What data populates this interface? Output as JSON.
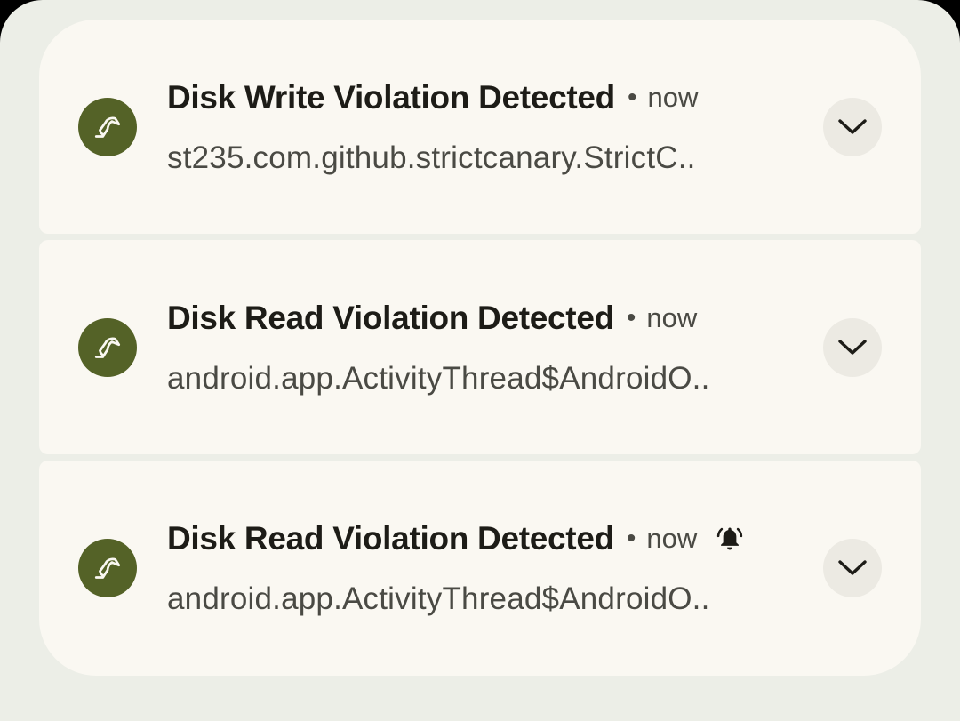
{
  "colors": {
    "shade_background": "#eceee7",
    "card_background": "#faf8f2",
    "app_icon_background": "#546227",
    "title_text": "#1d1c17",
    "secondary_text": "#4a4a44"
  },
  "notifications": [
    {
      "icon": "canary-bird-icon",
      "title": "Disk Write Violation Detected",
      "separator": "•",
      "time": "now",
      "body": "st235.com.github.strictcanary.StrictC..",
      "alerting": false,
      "expand_icon": "chevron-down-icon"
    },
    {
      "icon": "canary-bird-icon",
      "title": "Disk Read Violation Detected",
      "separator": "•",
      "time": "now",
      "body": "android.app.ActivityThread$AndroidO..",
      "alerting": false,
      "expand_icon": "chevron-down-icon"
    },
    {
      "icon": "canary-bird-icon",
      "title": "Disk Read Violation Detected",
      "separator": "•",
      "time": "now",
      "body": "android.app.ActivityThread$AndroidO..",
      "alerting": true,
      "alert_icon": "bell-ringing-icon",
      "expand_icon": "chevron-down-icon"
    }
  ]
}
